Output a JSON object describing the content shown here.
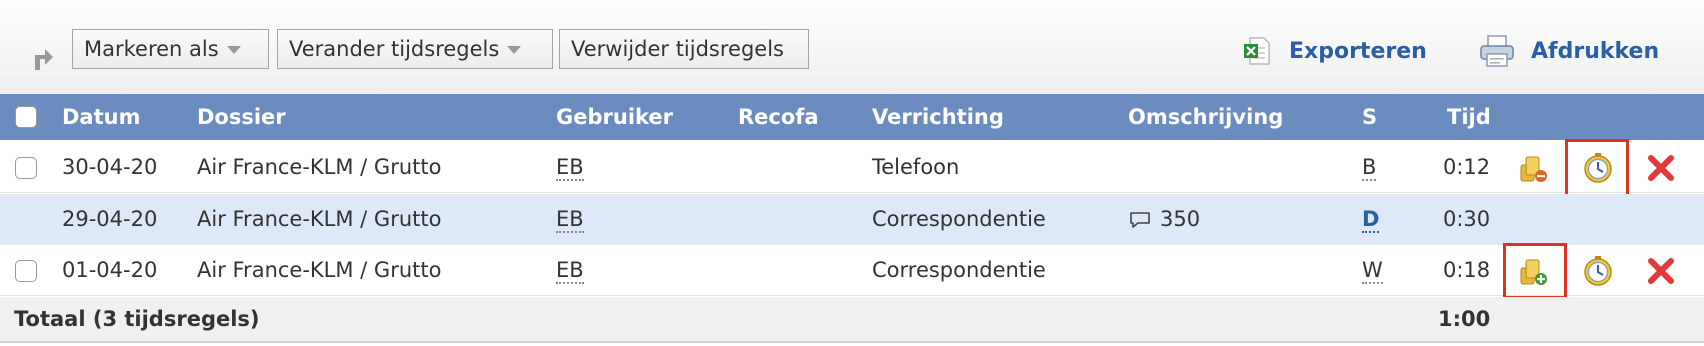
{
  "toolbar": {
    "mark_as": "Markeren als",
    "change_lines": "Verander tijdsregels",
    "delete_lines": "Verwijder tijdsregels",
    "export": "Exporteren",
    "print": "Afdrukken"
  },
  "columns": {
    "datum": "Datum",
    "dossier": "Dossier",
    "gebruiker": "Gebruiker",
    "recofa": "Recofa",
    "verrichting": "Verrichting",
    "omschrijving": "Omschrijving",
    "s": "S",
    "tijd": "Tijd"
  },
  "rows": [
    {
      "date": "30-04-20",
      "dossier": "Air France-KLM / Grutto",
      "user": "EB",
      "recofa": "",
      "action": "Telefoon",
      "description": "",
      "status": "B",
      "time": "0:12"
    },
    {
      "date": "29-04-20",
      "dossier": "Air France-KLM / Grutto",
      "user": "EB",
      "recofa": "",
      "action": "Correspondentie",
      "description": "350",
      "status": "D",
      "time": "0:30"
    },
    {
      "date": "01-04-20",
      "dossier": "Air France-KLM / Grutto",
      "user": "EB",
      "recofa": "",
      "action": "Correspondentie",
      "description": "",
      "status": "W",
      "time": "0:18"
    }
  ],
  "total": {
    "label": "Totaal (3 tijdsregels)",
    "time": "1:00"
  },
  "colors": {
    "header_bg": "#6b8cbe",
    "link": "#2a5fa8",
    "highlight": "#e0321f",
    "alt_row": "#dde9f8",
    "delete": "#e03a3a"
  }
}
